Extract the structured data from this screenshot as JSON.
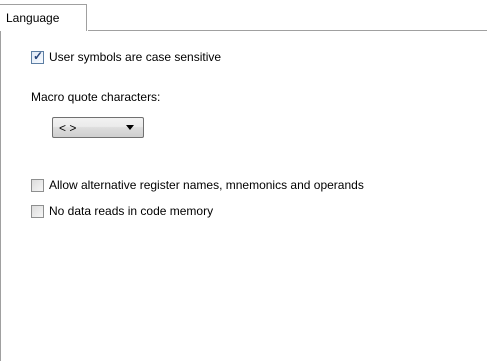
{
  "tabs": [
    {
      "label": "Language",
      "active": true
    }
  ],
  "options": {
    "case_sensitive": {
      "label": "User symbols are case sensitive",
      "checked": true
    },
    "macro_quote": {
      "label": "Macro quote characters:",
      "selected": "< >"
    },
    "alt_register_names": {
      "label": "Allow alternative register names, mnemonics and operands",
      "checked": false
    },
    "no_data_reads": {
      "label": "No data reads in code memory",
      "checked": false
    }
  },
  "icons": {
    "checkmark": "check-icon",
    "dropdown": "chevron-down-icon"
  }
}
